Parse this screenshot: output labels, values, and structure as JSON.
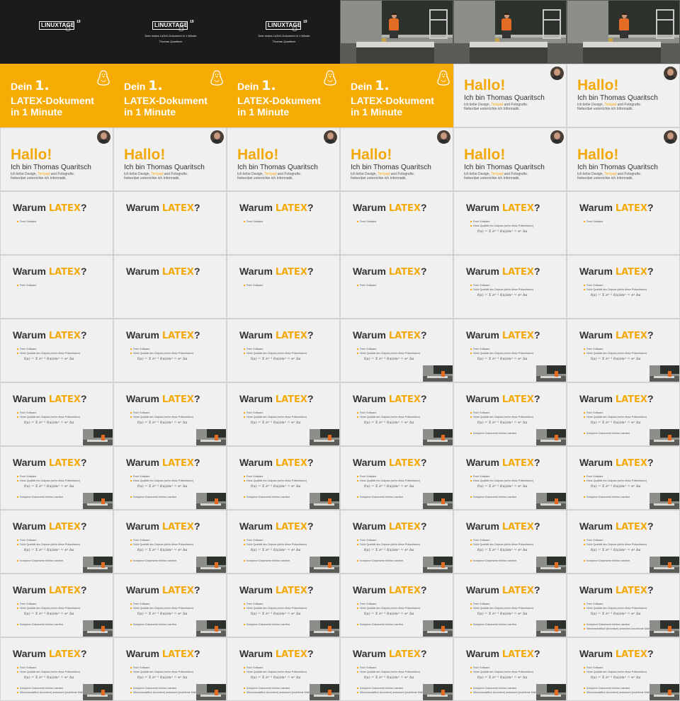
{
  "brand": {
    "orange": "#f7ac04",
    "dark": "#1b1b1b",
    "light": "#f0f0f0",
    "text": "#333333"
  },
  "title_card": {
    "logo": "LINUXTAGE",
    "logo_superscript": "19",
    "subtitle": "Dein erstes LaTeX-Dokument in 1 Minute",
    "author": "Thomas Quaritsch"
  },
  "orange_slide": {
    "line1_prefix": "Dein ",
    "line1_number": "1.",
    "line2": "LATEX-Dokument",
    "line3": "in 1 Minute"
  },
  "hallo_slide": {
    "heading": "Hallo!",
    "subheading": "Ich bin Thomas Quaritsch",
    "line1_prefix": "Ich liebe Design, ",
    "line1_highlight": "TeXpad",
    "line1_suffix": " und Fotografie.",
    "line2": "Nebenbei unterrichte ich Informatik."
  },
  "warum_slide": {
    "heading_prefix": "Warum ",
    "heading_logo": "LATEX",
    "heading_suffix": "?",
    "bullets": [
      "Freie Software",
      "Hohe Qualität des Outputs (siehe diese Präsentation)",
      "Komplexe Dokumente bleiben wartbar",
      "Wissenschaftlich (technisch) anerkannt (exzellente Mathematik)"
    ],
    "formula": "f(x) = Σ ∂ⁿ⁻¹ f(x)/∂xⁿ = eˣ Δx"
  },
  "grid": {
    "columns": 6,
    "rows": 11,
    "tiles": [
      {
        "kind": "dark",
        "variant": "logo"
      },
      {
        "kind": "dark",
        "variant": "logo-sub"
      },
      {
        "kind": "dark",
        "variant": "logo-sub"
      },
      {
        "kind": "video",
        "variant": "v1"
      },
      {
        "kind": "video",
        "variant": "v2"
      },
      {
        "kind": "video",
        "variant": "v3"
      },
      {
        "kind": "orange"
      },
      {
        "kind": "orange"
      },
      {
        "kind": "orange"
      },
      {
        "kind": "orange"
      },
      {
        "kind": "hallo",
        "variant": "top"
      },
      {
        "kind": "hallo",
        "variant": "top"
      },
      {
        "kind": "hallo"
      },
      {
        "kind": "hallo"
      },
      {
        "kind": "hallo"
      },
      {
        "kind": "hallo"
      },
      {
        "kind": "hallo"
      },
      {
        "kind": "hallo"
      },
      {
        "kind": "warum",
        "bullets": 1
      },
      {
        "kind": "warum",
        "bullets": 0
      },
      {
        "kind": "warum",
        "bullets": 1
      },
      {
        "kind": "warum",
        "bullets": 1
      },
      {
        "kind": "warum",
        "bullets": 2,
        "formula": true
      },
      {
        "kind": "warum",
        "bullets": 1
      },
      {
        "kind": "warum",
        "bullets": 1
      },
      {
        "kind": "warum",
        "bullets": 0
      },
      {
        "kind": "warum",
        "bullets": 1
      },
      {
        "kind": "warum",
        "bullets": 1
      },
      {
        "kind": "warum",
        "bullets": 2,
        "formula": true
      },
      {
        "kind": "warum",
        "bullets": 2,
        "formula": true
      },
      {
        "kind": "warum",
        "bullets": 2,
        "formula": true
      },
      {
        "kind": "warum",
        "bullets": 2,
        "formula": true
      },
      {
        "kind": "warum",
        "bullets": 2,
        "formula": true
      },
      {
        "kind": "warum",
        "bullets": 2,
        "formula": true,
        "pip": true
      },
      {
        "kind": "warum",
        "bullets": 2,
        "formula": true,
        "pip": true
      },
      {
        "kind": "warum",
        "bullets": 2,
        "formula": true,
        "pip": true
      },
      {
        "kind": "warum",
        "bullets": 2,
        "formula": true,
        "pip": true
      },
      {
        "kind": "warum",
        "bullets": 2,
        "formula": true,
        "pip": true
      },
      {
        "kind": "warum",
        "bullets": 2,
        "formula": true,
        "pip": true
      },
      {
        "kind": "warum",
        "bullets": 2,
        "formula": true,
        "pip": true
      },
      {
        "kind": "warum",
        "bullets": 3,
        "formula": true,
        "pip": true
      },
      {
        "kind": "warum",
        "bullets": 3,
        "formula": true,
        "pip": true
      },
      {
        "kind": "warum",
        "bullets": 3,
        "formula": true,
        "pip": true
      },
      {
        "kind": "warum",
        "bullets": 3,
        "formula": true,
        "pip": true
      },
      {
        "kind": "warum",
        "bullets": 3,
        "formula": true,
        "pip": true
      },
      {
        "kind": "warum",
        "bullets": 3,
        "formula": true,
        "pip": true
      },
      {
        "kind": "warum",
        "bullets": 3,
        "formula": true,
        "pip": true
      },
      {
        "kind": "warum",
        "bullets": 3,
        "formula": true,
        "pip": true
      },
      {
        "kind": "warum",
        "bullets": 3,
        "formula": true,
        "pip": true
      },
      {
        "kind": "warum",
        "bullets": 3,
        "formula": true,
        "pip": true
      },
      {
        "kind": "warum",
        "bullets": 3,
        "formula": true,
        "pip": true
      },
      {
        "kind": "warum",
        "bullets": 3,
        "formula": true,
        "pip": true
      },
      {
        "kind": "warum",
        "bullets": 3,
        "formula": true,
        "pip": true
      },
      {
        "kind": "warum",
        "bullets": 3,
        "formula": true,
        "pip": true
      },
      {
        "kind": "warum",
        "bullets": 3,
        "formula": true,
        "pip": true
      },
      {
        "kind": "warum",
        "bullets": 3,
        "formula": true,
        "pip": true
      },
      {
        "kind": "warum",
        "bullets": 3,
        "formula": true,
        "pip": true
      },
      {
        "kind": "warum",
        "bullets": 3,
        "formula": true,
        "pip": true
      },
      {
        "kind": "warum",
        "bullets": 3,
        "formula": true,
        "pip": true
      },
      {
        "kind": "warum",
        "bullets": 4,
        "formula": true,
        "pip": true
      },
      {
        "kind": "warum",
        "bullets": 4,
        "formula": true,
        "pip": true
      },
      {
        "kind": "warum",
        "bullets": 4,
        "formula": true,
        "pip": true
      },
      {
        "kind": "warum",
        "bullets": 4,
        "formula": true,
        "pip": true
      },
      {
        "kind": "warum",
        "bullets": 4,
        "formula": true,
        "pip": true
      },
      {
        "kind": "warum",
        "bullets": 4,
        "formula": true,
        "pip": true
      },
      {
        "kind": "warum",
        "bullets": 4,
        "formula": true,
        "pip": true
      }
    ]
  }
}
